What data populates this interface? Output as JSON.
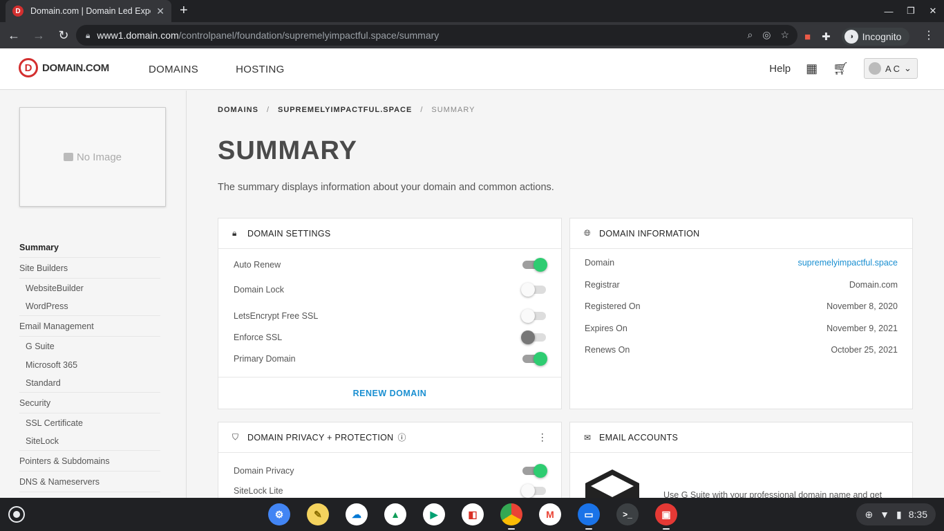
{
  "browser": {
    "tab_title": "Domain.com | Domain Led Expe",
    "url_host": "www1.domain.com",
    "url_path": "/controlpanel/foundation/supremelyimpactful.space/summary",
    "incognito_label": "Incognito"
  },
  "header": {
    "logo_text": "DOMAIN.COM",
    "nav": [
      "DOMAINS",
      "HOSTING"
    ],
    "help": "Help",
    "user_initials": "A C"
  },
  "sidebar": {
    "no_image": "No Image",
    "items": [
      {
        "label": "Summary",
        "type": "top",
        "active": true
      },
      {
        "label": "Site Builders",
        "type": "top"
      },
      {
        "label": "WebsiteBuilder",
        "type": "sub"
      },
      {
        "label": "WordPress",
        "type": "sub"
      },
      {
        "label": "Email Management",
        "type": "top"
      },
      {
        "label": "G Suite",
        "type": "sub"
      },
      {
        "label": "Microsoft 365",
        "type": "sub"
      },
      {
        "label": "Standard",
        "type": "sub"
      },
      {
        "label": "Security",
        "type": "top"
      },
      {
        "label": "SSL Certificate",
        "type": "sub"
      },
      {
        "label": "SiteLock",
        "type": "sub"
      },
      {
        "label": "Pointers & Subdomains",
        "type": "top"
      },
      {
        "label": "DNS & Nameservers",
        "type": "top"
      }
    ]
  },
  "breadcrumb": [
    "DOMAINS",
    "SUPREMELYIMPACTFUL.SPACE",
    "SUMMARY"
  ],
  "page": {
    "title": "SUMMARY",
    "description": "The summary displays information about your domain and common actions."
  },
  "domain_settings": {
    "title": "DOMAIN SETTINGS",
    "rows": [
      {
        "label": "Auto Renew",
        "state": "on"
      },
      {
        "label": "Domain Lock",
        "state": "off"
      },
      {
        "label": "LetsEncrypt Free SSL",
        "state": "off"
      },
      {
        "label": "Enforce SSL",
        "state": "grey"
      },
      {
        "label": "Primary Domain",
        "state": "on"
      }
    ],
    "action": "RENEW DOMAIN"
  },
  "domain_information": {
    "title": "DOMAIN INFORMATION",
    "rows": [
      {
        "label": "Domain",
        "value": "supremelyimpactful.space",
        "link": true
      },
      {
        "label": "Registrar",
        "value": "Domain.com"
      },
      {
        "label": "Registered On",
        "value": "November 8, 2020"
      },
      {
        "label": "Expires On",
        "value": "November 9, 2021"
      },
      {
        "label": "Renews On",
        "value": "October 25, 2021"
      }
    ]
  },
  "privacy": {
    "title": "DOMAIN PRIVACY + PROTECTION",
    "rows": [
      {
        "label": "Domain Privacy",
        "state": "on"
      },
      {
        "label": "SiteLock Lite",
        "state": "off"
      }
    ]
  },
  "email": {
    "title": "EMAIL ACCOUNTS",
    "text": "Use G Suite with your professional domain name and get"
  },
  "shelf": {
    "time": "8:35"
  }
}
